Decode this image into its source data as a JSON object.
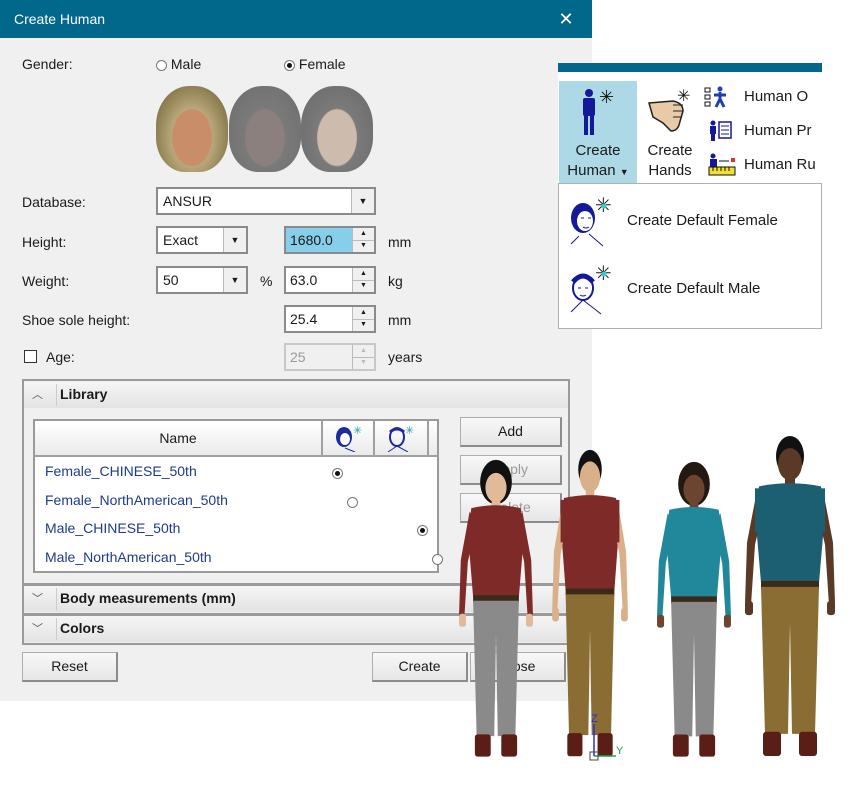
{
  "dialog": {
    "title": "Create Human",
    "close_icon": "close-icon",
    "gender": {
      "label": "Gender:",
      "options": [
        {
          "label": "Male",
          "selected": false
        },
        {
          "label": "Female",
          "selected": true
        }
      ],
      "face_thumbnails": [
        {
          "name": "caucasian-female-face",
          "selected": true
        },
        {
          "name": "african-female-face",
          "selected": false
        },
        {
          "name": "asian-female-face",
          "selected": false
        }
      ]
    },
    "database": {
      "label": "Database:",
      "value": "ANSUR"
    },
    "height": {
      "label": "Height:",
      "mode": "Exact",
      "value": "1680.0",
      "unit": "mm"
    },
    "weight": {
      "label": "Weight:",
      "percentile": "50",
      "percent_sign": "%",
      "value": "63.0",
      "unit": "kg"
    },
    "shoe_sole": {
      "label": "Shoe sole height:",
      "value": "25.4",
      "unit": "mm"
    },
    "age": {
      "label": "Age:",
      "checked": false,
      "value": "25",
      "unit": "years"
    },
    "library": {
      "title": "Library",
      "expanded": true,
      "columns": {
        "name": "Name",
        "female_icon": "female-head-icon",
        "male_icon": "male-head-icon"
      },
      "rows": [
        {
          "name": "Female_CHINESE_50th",
          "female_default": true,
          "male_default": null
        },
        {
          "name": "Female_NorthAmerican_50th",
          "female_default": false,
          "male_default": null
        },
        {
          "name": "Male_CHINESE_50th",
          "female_default": null,
          "male_default": true
        },
        {
          "name": "Male_NorthAmerican_50th",
          "female_default": null,
          "male_default": false
        }
      ],
      "buttons": {
        "add": "Add",
        "apply": "Apply",
        "delete": "Delete"
      }
    },
    "body_measurements": {
      "title": "Body measurements (mm)",
      "expanded": false
    },
    "colors": {
      "title": "Colors",
      "expanded": false
    },
    "footer": {
      "reset": "Reset",
      "create": "Create",
      "close": "Close"
    }
  },
  "ribbon": {
    "create_human": {
      "line1": "Create",
      "line2": "Human",
      "has_dropdown": true,
      "active": true
    },
    "create_hands": {
      "line1": "Create",
      "line2": "Hands"
    },
    "small_items": [
      {
        "label": "Human Operations",
        "visible_label": "Human O",
        "icon": "human-operations-icon"
      },
      {
        "label": "Human Properties",
        "visible_label": "Human Pr",
        "icon": "human-properties-icon"
      },
      {
        "label": "Human Ruler",
        "visible_label": "Human Ru",
        "icon": "human-ruler-icon"
      }
    ],
    "dropdown": [
      {
        "label": "Create Default Female",
        "icon": "default-female-icon"
      },
      {
        "label": "Create Default Male",
        "icon": "default-male-icon"
      }
    ]
  },
  "viewport": {
    "figures": [
      {
        "name": "chinese-female-figure",
        "shirt": "#7d2a28",
        "pants": "#8a8a8a",
        "skin": "#e3b99b",
        "hair": "#111111"
      },
      {
        "name": "chinese-male-figure",
        "shirt": "#7d2a28",
        "pants": "#8a6d33",
        "skin": "#d9b08a",
        "hair": "#111111"
      },
      {
        "name": "northamerican-female-figure",
        "shirt": "#21879a",
        "pants": "#8a8a8a",
        "skin": "#6b4530",
        "hair": "#241812"
      },
      {
        "name": "northamerican-male-figure",
        "shirt": "#1d5f72",
        "pants": "#8a6d33",
        "skin": "#5a3a26",
        "hair": "#111111"
      }
    ],
    "axes": {
      "z": "Z",
      "y": "Y"
    }
  },
  "colors": {
    "titlebar": "#01688b",
    "highlight": "#87ceeb",
    "ribbon_active": "#add8e6",
    "link_text": "#1e3b8c"
  }
}
